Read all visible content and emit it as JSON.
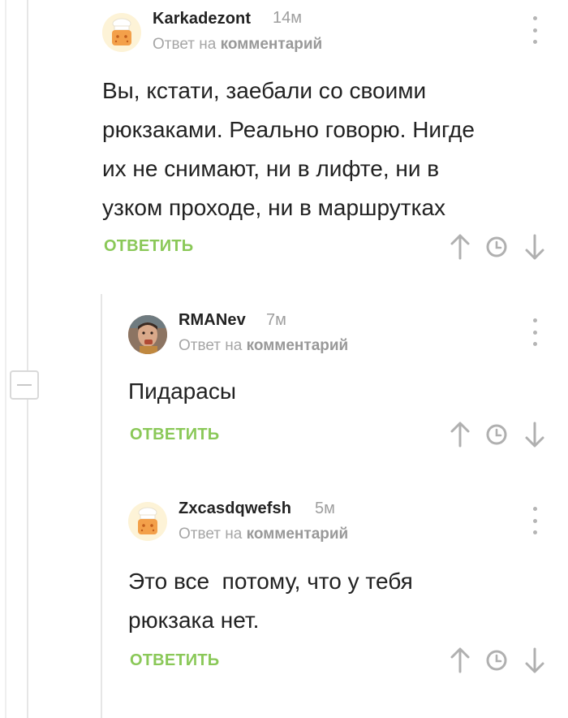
{
  "comments": [
    {
      "username": "Karkadezont",
      "time": "14м",
      "reply_prefix": "Ответ на",
      "reply_target": "комментарий",
      "body": "Вы, кстати, заебали со своими\nрюкзаками. Реально говорю. Нигде\nих не снимают, ни в лифте, ни в\nузком проходе, ни в маршрутках",
      "reply_label": "ОТВЕТИТЬ",
      "avatar": "default-chef-avatar"
    },
    {
      "username": "RMANev",
      "time": "7м",
      "reply_prefix": "Ответ на",
      "reply_target": "комментарий",
      "body": "Пидарасы",
      "reply_label": "ОТВЕТИТЬ",
      "avatar": "user-photo-avatar"
    },
    {
      "username": "Zxcasdqwefsh",
      "time": "5м",
      "reply_prefix": "Ответ на",
      "reply_target": "комментарий",
      "body": "Это все  потому, что у тебя\nрюкзака нет.",
      "reply_label": "ОТВЕТИТЬ",
      "avatar": "default-chef-avatar"
    }
  ],
  "colors": {
    "accent_green": "#8ac858",
    "muted_gray": "#a6a6a6",
    "icon_gray": "#b0b0b0"
  }
}
